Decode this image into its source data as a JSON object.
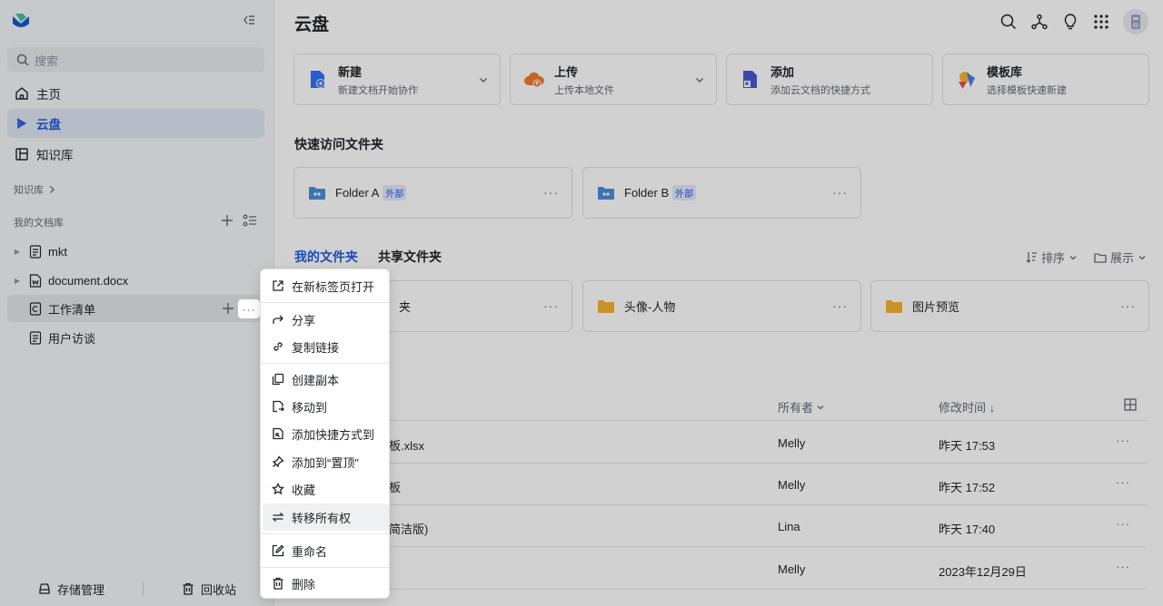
{
  "sidebar": {
    "search_placeholder": "搜索",
    "nav": [
      {
        "label": "主页"
      },
      {
        "label": "云盘"
      },
      {
        "label": "知识库"
      }
    ],
    "wiki_section": "知识库",
    "mydocs_section": "我的文档库",
    "tree": [
      {
        "label": "mkt"
      },
      {
        "label": "document.docx"
      },
      {
        "label": "工作清单"
      },
      {
        "label": "用户访谈"
      }
    ],
    "footer": {
      "storage": "存储管理",
      "trash": "回收站"
    }
  },
  "header": {
    "title": "云盘"
  },
  "actions": [
    {
      "title": "新建",
      "sub": "新建文档开始协作"
    },
    {
      "title": "上传",
      "sub": "上传本地文件"
    },
    {
      "title": "添加",
      "sub": "添加云文档的快捷方式"
    },
    {
      "title": "模板库",
      "sub": "选择模板快速新建"
    }
  ],
  "quick_access": {
    "title": "快速访问文件夹",
    "folders": [
      {
        "name": "Folder A",
        "tag": "外部"
      },
      {
        "name": "Folder B",
        "tag": "外部"
      }
    ]
  },
  "tabs": {
    "mine": "我的文件夹",
    "shared": "共享文件夹"
  },
  "sort_label": "排序",
  "view_label": "展示",
  "my_folders": [
    {
      "name": "夹"
    },
    {
      "name": "头像-人物"
    },
    {
      "name": "图片预览"
    }
  ],
  "list": {
    "col_owner": "所有者",
    "col_modified": "修改时间 ↓",
    "rows": [
      {
        "name": "板.xlsx",
        "owner": "Melly",
        "time": "昨天 17:53"
      },
      {
        "name": "板",
        "owner": "Melly",
        "time": "昨天 17:52"
      },
      {
        "name": "简洁版)",
        "owner": "Lina",
        "time": "昨天 17:40"
      },
      {
        "name": "",
        "owner": "Melly",
        "time": "2023年12月29日"
      }
    ]
  },
  "context_menu": {
    "items": [
      {
        "label": "在新标签页打开"
      },
      {
        "label": "分享"
      },
      {
        "label": "复制链接"
      },
      {
        "label": "创建副本"
      },
      {
        "label": "移动到"
      },
      {
        "label": "添加快捷方式到"
      },
      {
        "label": "添加到“置顶”"
      },
      {
        "label": "收藏"
      },
      {
        "label": "转移所有权"
      },
      {
        "label": "重命名"
      },
      {
        "label": "删除"
      }
    ]
  },
  "colors": {
    "accent": "#245bdb",
    "folder": "#f5b432",
    "folder_blue": "#4a90d9"
  }
}
